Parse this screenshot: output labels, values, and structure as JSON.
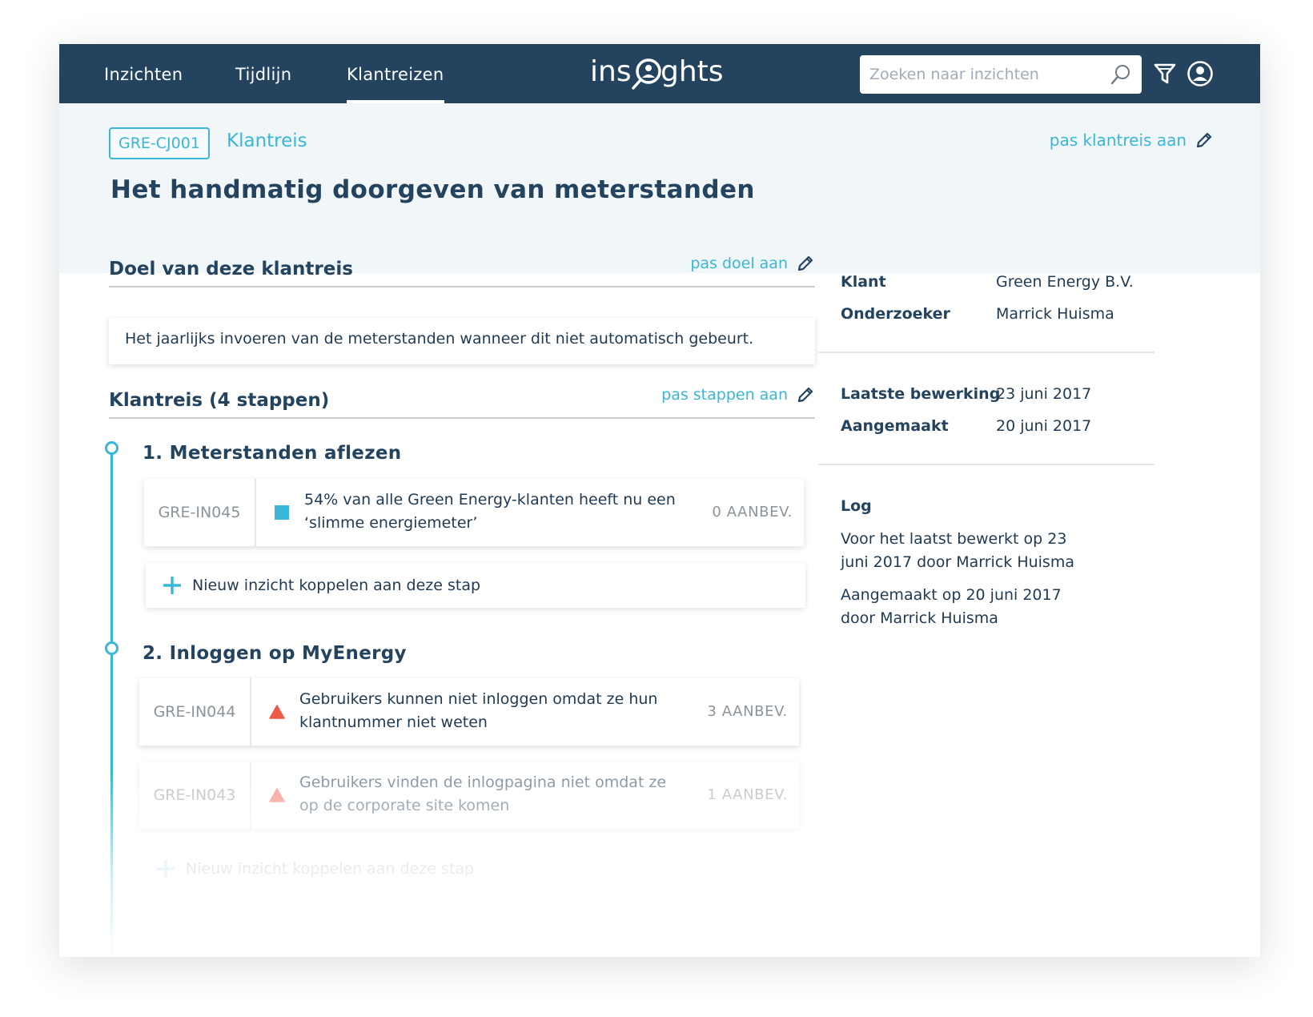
{
  "nav": {
    "items": [
      {
        "label": "Inzichten"
      },
      {
        "label": "Tijdlijn"
      },
      {
        "label": "Klantreizen"
      }
    ],
    "active": "Klantreizen",
    "logo_text": "insights",
    "search_placeholder": "Zoeken naar inzichten"
  },
  "header": {
    "badge": "GRE-CJ001",
    "crumb": "Klantreis",
    "edit_label": "pas klantreis aan",
    "title": "Het handmatig doorgeven van meterstanden"
  },
  "goal": {
    "title": "Doel van deze klantreis",
    "edit_label": "pas doel aan",
    "text": "Het jaarlijks invoeren van de meterstanden wanneer dit niet automatisch gebeurt."
  },
  "journey": {
    "title": "Klantreis (4 stappen)",
    "edit_label": "pas stappen aan",
    "add_label": "Nieuw inzicht koppelen aan deze stap",
    "steps": [
      {
        "title": "1. Meterstanden aflezen",
        "insights": [
          {
            "id": "GRE-IN045",
            "marker": "square-icon",
            "color": "#3ab6d6",
            "text_line1": "54% van alle Green Energy-klanten heeft nu een",
            "text_line2": "‘slimme energiemeter’",
            "count": "0 AANBEV."
          }
        ]
      },
      {
        "title": "2. Inloggen op MyEnergy",
        "insights": [
          {
            "id": "GRE-IN044",
            "marker": "warning-triangle-icon",
            "color": "#ee5a48",
            "text_line1": "Gebruikers kunnen niet inloggen omdat ze hun",
            "text_line2": "klantnummer niet weten",
            "count": "3 AANBEV."
          },
          {
            "id": "GRE-IN043",
            "marker": "warning-triangle-icon",
            "color": "#ee5a48",
            "text_line1": "Gebruikers vinden de inlogpagina niet omdat ze",
            "text_line2": "op de corporate site komen",
            "count": "1 AANBEV."
          }
        ]
      }
    ]
  },
  "sidebar": {
    "meta": [
      {
        "label": "Klant",
        "value": "Green Energy B.V."
      },
      {
        "label": "Onderzoeker",
        "value": "Marrick Huisma"
      },
      {
        "label": "Laatste bewerking",
        "value": "23 juni 2017"
      },
      {
        "label": "Aangemaakt",
        "value": "20 juni 2017"
      }
    ],
    "log": {
      "title": "Log",
      "entries": [
        {
          "line1": "Voor het laatst bewerkt op 23",
          "line2": "juni 2017 door Marrick Huisma"
        },
        {
          "line1": "Aangemaakt op 20 juni 2017",
          "line2": "door Marrick Huisma"
        }
      ]
    }
  },
  "colors": {
    "nav": "#23435f",
    "accent": "#3ab6d6",
    "warning": "#ee5a48",
    "header_bg": "#f1f6f9"
  }
}
